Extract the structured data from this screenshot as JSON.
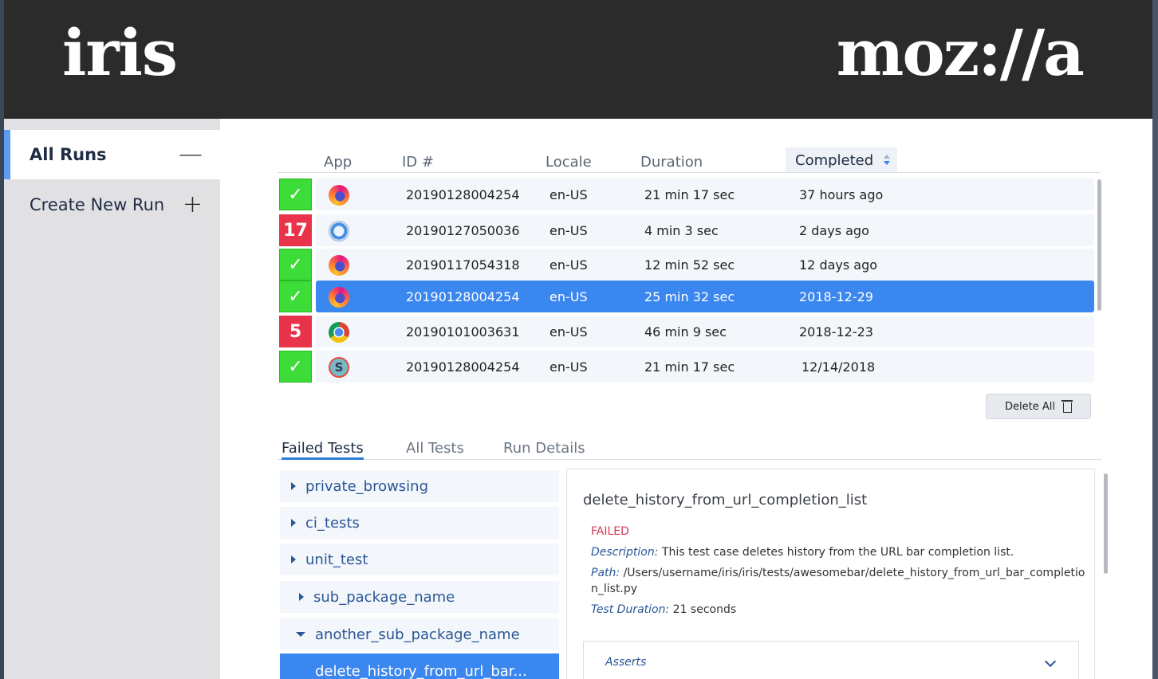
{
  "header": {
    "product": "iris",
    "brand": "moz://a"
  },
  "sidebar": {
    "items": [
      {
        "label": "All Runs",
        "glyph": "—"
      },
      {
        "label": "Create New Run",
        "glyph": "+"
      }
    ]
  },
  "runs_table": {
    "columns": [
      "App",
      "ID #",
      "Locale",
      "Duration",
      "Completed"
    ],
    "sorted_column": "Completed",
    "rows": [
      {
        "status": "pass",
        "status_text": "✓",
        "app_icon": "firefox-icon",
        "id": "20190128004254",
        "locale": "en-US",
        "duration": "21 min 17 sec",
        "completed": "37 hours ago"
      },
      {
        "status": "fail",
        "status_text": "17",
        "app_icon": "safari-icon",
        "id": "20190127050036",
        "locale": "en-US",
        "duration": "4 min 3 sec",
        "completed": "2 days ago"
      },
      {
        "status": "pass",
        "status_text": "✓",
        "app_icon": "firefox-icon",
        "id": "20190117054318",
        "locale": "en-US",
        "duration": "12 min 52 sec",
        "completed": "12 days ago"
      },
      {
        "status": "pass",
        "status_text": "✓",
        "app_icon": "firefox-icon",
        "id": "20190128004254",
        "locale": "en-US",
        "duration": "25 min 32 sec",
        "completed": "2018-12-29",
        "selected": true
      },
      {
        "status": "fail",
        "status_text": "5",
        "app_icon": "chrome-icon",
        "id": "20190101003631",
        "locale": "en-US",
        "duration": "46 min 9 sec",
        "completed": "2018-12-23"
      },
      {
        "status": "pass",
        "status_text": "✓",
        "app_icon": "s-app-icon",
        "app_letter": "S",
        "id": "20190128004254",
        "locale": "en-US",
        "duration": "21 min 17 sec",
        "completed": "12/14/2018"
      }
    ],
    "delete_all_label": "Delete All"
  },
  "tabs": [
    "Failed Tests",
    "All Tests",
    "Run Details"
  ],
  "tree": {
    "items": [
      {
        "label": "private_browsing",
        "expanded": false
      },
      {
        "label": "ci_tests",
        "expanded": false
      },
      {
        "label": "unit_test",
        "expanded": false
      },
      {
        "label": "sub_package_name",
        "expanded": false
      },
      {
        "label": "another_sub_package_name",
        "expanded": true
      },
      {
        "label": "delete_history_from_url_bar...",
        "selected": true
      }
    ]
  },
  "detail": {
    "title": "delete_history_from_url_completion_list",
    "status": "FAILED",
    "description_label": "Description:",
    "description": "This test case deletes history from the URL bar completion list.",
    "path_label": "Path:",
    "path": "/Users/username/iris/iris/tests/awesomebar/delete_history_from_url_bar_completion_list.py",
    "duration_label": "Test Duration:",
    "duration": "21 seconds",
    "asserts_label": "Asserts"
  },
  "colors": {
    "pass": "#3ddc39",
    "fail": "#e8334a",
    "selected": "#3b87f0",
    "header": "#2b2b2b",
    "sidebar": "#e1e0e3"
  }
}
